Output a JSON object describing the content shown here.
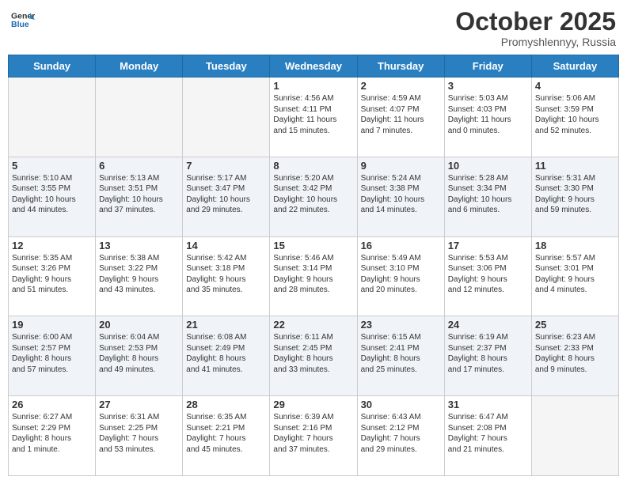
{
  "header": {
    "logo_general": "General",
    "logo_blue": "Blue",
    "month": "October 2025",
    "location": "Promyshlennyy, Russia"
  },
  "days": [
    "Sunday",
    "Monday",
    "Tuesday",
    "Wednesday",
    "Thursday",
    "Friday",
    "Saturday"
  ],
  "weeks": [
    [
      {
        "num": "",
        "info": ""
      },
      {
        "num": "",
        "info": ""
      },
      {
        "num": "",
        "info": ""
      },
      {
        "num": "1",
        "info": "Sunrise: 4:56 AM\nSunset: 4:11 PM\nDaylight: 11 hours\nand 15 minutes."
      },
      {
        "num": "2",
        "info": "Sunrise: 4:59 AM\nSunset: 4:07 PM\nDaylight: 11 hours\nand 7 minutes."
      },
      {
        "num": "3",
        "info": "Sunrise: 5:03 AM\nSunset: 4:03 PM\nDaylight: 11 hours\nand 0 minutes."
      },
      {
        "num": "4",
        "info": "Sunrise: 5:06 AM\nSunset: 3:59 PM\nDaylight: 10 hours\nand 52 minutes."
      }
    ],
    [
      {
        "num": "5",
        "info": "Sunrise: 5:10 AM\nSunset: 3:55 PM\nDaylight: 10 hours\nand 44 minutes."
      },
      {
        "num": "6",
        "info": "Sunrise: 5:13 AM\nSunset: 3:51 PM\nDaylight: 10 hours\nand 37 minutes."
      },
      {
        "num": "7",
        "info": "Sunrise: 5:17 AM\nSunset: 3:47 PM\nDaylight: 10 hours\nand 29 minutes."
      },
      {
        "num": "8",
        "info": "Sunrise: 5:20 AM\nSunset: 3:42 PM\nDaylight: 10 hours\nand 22 minutes."
      },
      {
        "num": "9",
        "info": "Sunrise: 5:24 AM\nSunset: 3:38 PM\nDaylight: 10 hours\nand 14 minutes."
      },
      {
        "num": "10",
        "info": "Sunrise: 5:28 AM\nSunset: 3:34 PM\nDaylight: 10 hours\nand 6 minutes."
      },
      {
        "num": "11",
        "info": "Sunrise: 5:31 AM\nSunset: 3:30 PM\nDaylight: 9 hours\nand 59 minutes."
      }
    ],
    [
      {
        "num": "12",
        "info": "Sunrise: 5:35 AM\nSunset: 3:26 PM\nDaylight: 9 hours\nand 51 minutes."
      },
      {
        "num": "13",
        "info": "Sunrise: 5:38 AM\nSunset: 3:22 PM\nDaylight: 9 hours\nand 43 minutes."
      },
      {
        "num": "14",
        "info": "Sunrise: 5:42 AM\nSunset: 3:18 PM\nDaylight: 9 hours\nand 35 minutes."
      },
      {
        "num": "15",
        "info": "Sunrise: 5:46 AM\nSunset: 3:14 PM\nDaylight: 9 hours\nand 28 minutes."
      },
      {
        "num": "16",
        "info": "Sunrise: 5:49 AM\nSunset: 3:10 PM\nDaylight: 9 hours\nand 20 minutes."
      },
      {
        "num": "17",
        "info": "Sunrise: 5:53 AM\nSunset: 3:06 PM\nDaylight: 9 hours\nand 12 minutes."
      },
      {
        "num": "18",
        "info": "Sunrise: 5:57 AM\nSunset: 3:01 PM\nDaylight: 9 hours\nand 4 minutes."
      }
    ],
    [
      {
        "num": "19",
        "info": "Sunrise: 6:00 AM\nSunset: 2:57 PM\nDaylight: 8 hours\nand 57 minutes."
      },
      {
        "num": "20",
        "info": "Sunrise: 6:04 AM\nSunset: 2:53 PM\nDaylight: 8 hours\nand 49 minutes."
      },
      {
        "num": "21",
        "info": "Sunrise: 6:08 AM\nSunset: 2:49 PM\nDaylight: 8 hours\nand 41 minutes."
      },
      {
        "num": "22",
        "info": "Sunrise: 6:11 AM\nSunset: 2:45 PM\nDaylight: 8 hours\nand 33 minutes."
      },
      {
        "num": "23",
        "info": "Sunrise: 6:15 AM\nSunset: 2:41 PM\nDaylight: 8 hours\nand 25 minutes."
      },
      {
        "num": "24",
        "info": "Sunrise: 6:19 AM\nSunset: 2:37 PM\nDaylight: 8 hours\nand 17 minutes."
      },
      {
        "num": "25",
        "info": "Sunrise: 6:23 AM\nSunset: 2:33 PM\nDaylight: 8 hours\nand 9 minutes."
      }
    ],
    [
      {
        "num": "26",
        "info": "Sunrise: 6:27 AM\nSunset: 2:29 PM\nDaylight: 8 hours\nand 1 minute."
      },
      {
        "num": "27",
        "info": "Sunrise: 6:31 AM\nSunset: 2:25 PM\nDaylight: 7 hours\nand 53 minutes."
      },
      {
        "num": "28",
        "info": "Sunrise: 6:35 AM\nSunset: 2:21 PM\nDaylight: 7 hours\nand 45 minutes."
      },
      {
        "num": "29",
        "info": "Sunrise: 6:39 AM\nSunset: 2:16 PM\nDaylight: 7 hours\nand 37 minutes."
      },
      {
        "num": "30",
        "info": "Sunrise: 6:43 AM\nSunset: 2:12 PM\nDaylight: 7 hours\nand 29 minutes."
      },
      {
        "num": "31",
        "info": "Sunrise: 6:47 AM\nSunset: 2:08 PM\nDaylight: 7 hours\nand 21 minutes."
      },
      {
        "num": "",
        "info": ""
      }
    ]
  ]
}
